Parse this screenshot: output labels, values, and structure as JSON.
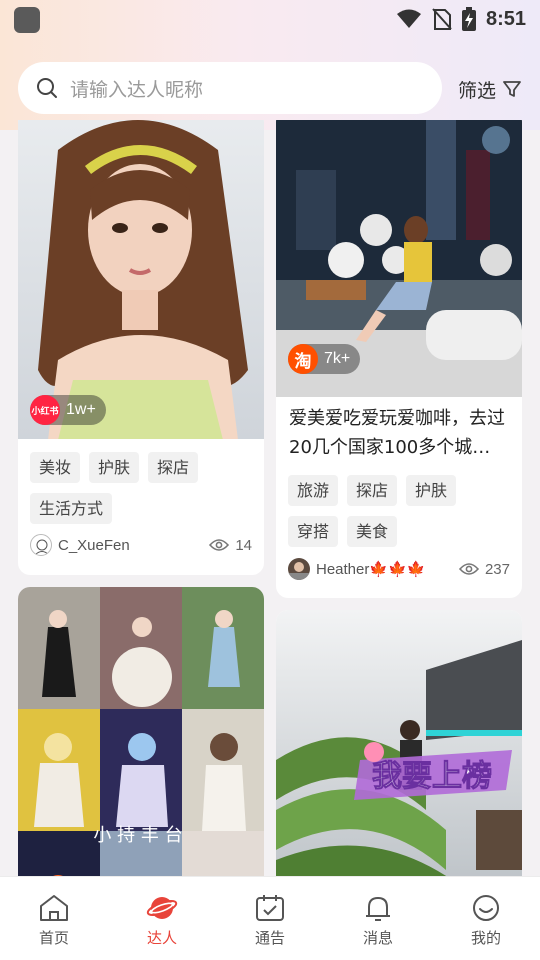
{
  "status_bar": {
    "time": "8:51"
  },
  "search": {
    "placeholder": "请输入达人昵称"
  },
  "filter": {
    "label": "筛选"
  },
  "cards": [
    {
      "platform_icon": "xiaohongshu-logo",
      "platform_text": "小红书",
      "platform_color": "#ff2442",
      "count": "1w+",
      "tags": [
        "美妆",
        "护肤",
        "探店",
        "生活方式"
      ],
      "author": "C_XueFen",
      "views": "14"
    },
    {
      "platform_icon": "taobao-logo",
      "platform_text": "淘",
      "platform_color": "#ff5000",
      "count": "7k+",
      "title": "爱美爱吃爱玩爱咖啡，去过20几个国家100多个城…",
      "tags": [
        "旅游",
        "探店",
        "护肤",
        "穿搭",
        "美食"
      ],
      "author": "Heather🍁🍁🍁",
      "views": "237"
    },
    {
      "overlay_text": "小 持  丰 台"
    },
    {
      "overlay_text": "我要上榜"
    }
  ],
  "tabbar": [
    {
      "label": "首页",
      "icon": "home-icon",
      "active": false
    },
    {
      "label": "达人",
      "icon": "planet-icon",
      "active": true
    },
    {
      "label": "通告",
      "icon": "calendar-icon",
      "active": false
    },
    {
      "label": "消息",
      "icon": "bell-icon",
      "active": false
    },
    {
      "label": "我的",
      "icon": "smile-icon",
      "active": false
    }
  ],
  "colors": {
    "accent": "#e8443a",
    "background": "#f3f1f3"
  }
}
